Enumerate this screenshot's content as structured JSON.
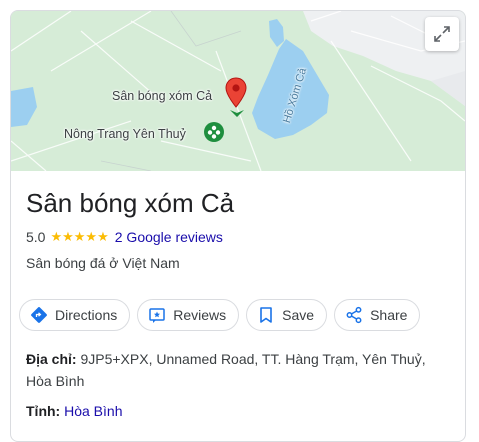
{
  "map": {
    "place_pin_label": "Sân bóng xóm Cả",
    "nearby_label": "Nông Trang Yên Thuỷ",
    "lake_label": "Hồ Xóm Cả",
    "expand_icon": "expand-icon"
  },
  "place": {
    "name": "Sân bóng xóm Cả",
    "rating": "5.0",
    "stars": "★★★★★",
    "reviews_link": "2 Google reviews",
    "category": "Sân bóng đá ở Việt Nam"
  },
  "actions": [
    {
      "label": "Directions",
      "icon": "directions-icon"
    },
    {
      "label": "Reviews",
      "icon": "reviews-icon"
    },
    {
      "label": "Save",
      "icon": "bookmark-icon"
    },
    {
      "label": "Share",
      "icon": "share-icon"
    }
  ],
  "details": {
    "address_label": "Địa chỉ:",
    "address_value": "9JP5+XPX, Unnamed Road, TT. Hàng Trạm, Yên Thuỷ, Hòa Bình",
    "province_label": "Tỉnh:",
    "province_value": "Hòa Bình"
  },
  "colors": {
    "star": "#fbbc04",
    "link": "#1a0dab",
    "pin": "#ea4335",
    "water": "#9ccff0",
    "park": "#d6ecd7"
  }
}
